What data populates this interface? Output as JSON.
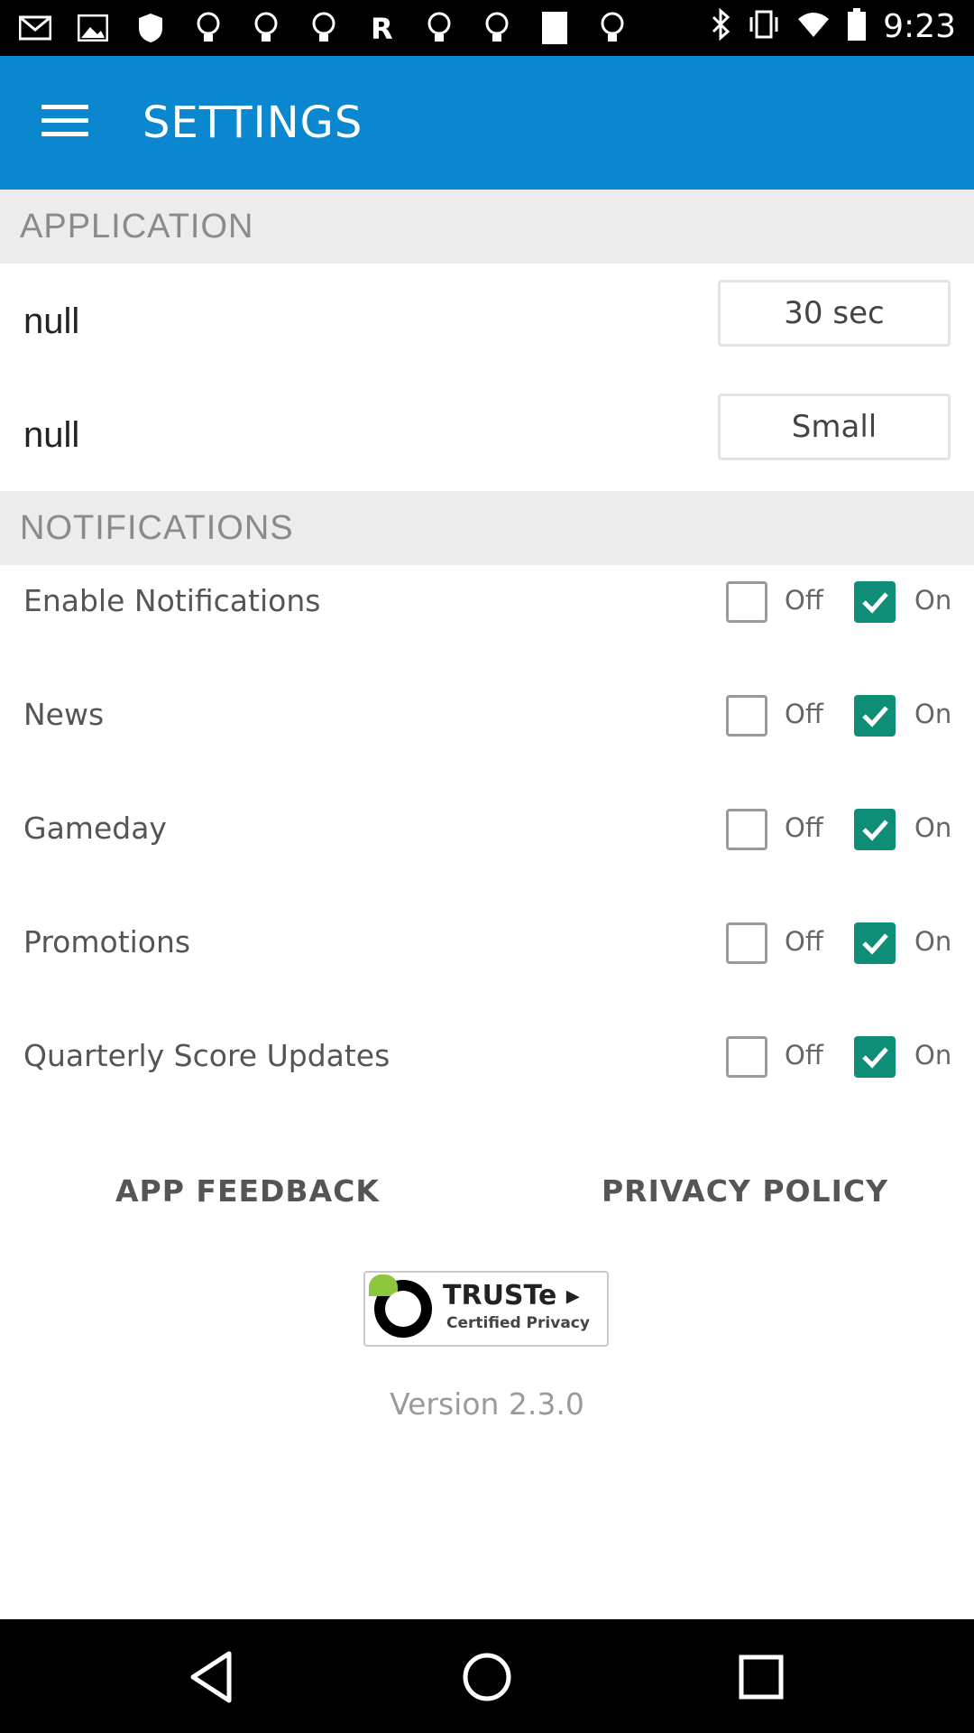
{
  "status_bar": {
    "time": "9:23",
    "icons": [
      "mail-icon",
      "image-icon",
      "shield-icon",
      "lightbulb-icon",
      "lightbulb-icon",
      "lightbulb-icon",
      "r-icon",
      "lightbulb-icon",
      "lightbulb-icon",
      "card-icon",
      "lightbulb-icon",
      "bluetooth-icon",
      "vibrate-icon",
      "wifi-icon",
      "battery-icon"
    ]
  },
  "app_bar": {
    "title": "SETTINGS",
    "menu_icon": "hamburger-menu-icon"
  },
  "application_section": {
    "header": "APPLICATION",
    "rows": [
      {
        "label": "null",
        "value": "30 sec"
      },
      {
        "label": "null",
        "value": "Small"
      }
    ]
  },
  "notifications_section": {
    "header": "NOTIFICATIONS",
    "off_label": "Off",
    "on_label": "On",
    "rows": [
      {
        "label": "Enable Notifications",
        "checked": "on"
      },
      {
        "label": "News",
        "checked": "on"
      },
      {
        "label": "Gameday",
        "checked": "on"
      },
      {
        "label": "Promotions",
        "checked": "on"
      },
      {
        "label": "Quarterly Score Updates",
        "checked": "on"
      }
    ]
  },
  "links": {
    "feedback": "APP FEEDBACK",
    "privacy": "PRIVACY POLICY"
  },
  "truste_badge": {
    "brand": "TRUSTe ▸",
    "subtitle": "Certified Privacy"
  },
  "version": "Version 2.3.0",
  "colors": {
    "app_bar": "#0A87CF",
    "checkbox_on": "#0E8E77",
    "section_bg": "#ececec"
  },
  "nav_bar": {
    "icons": [
      "back-icon",
      "home-icon",
      "recents-icon"
    ]
  }
}
